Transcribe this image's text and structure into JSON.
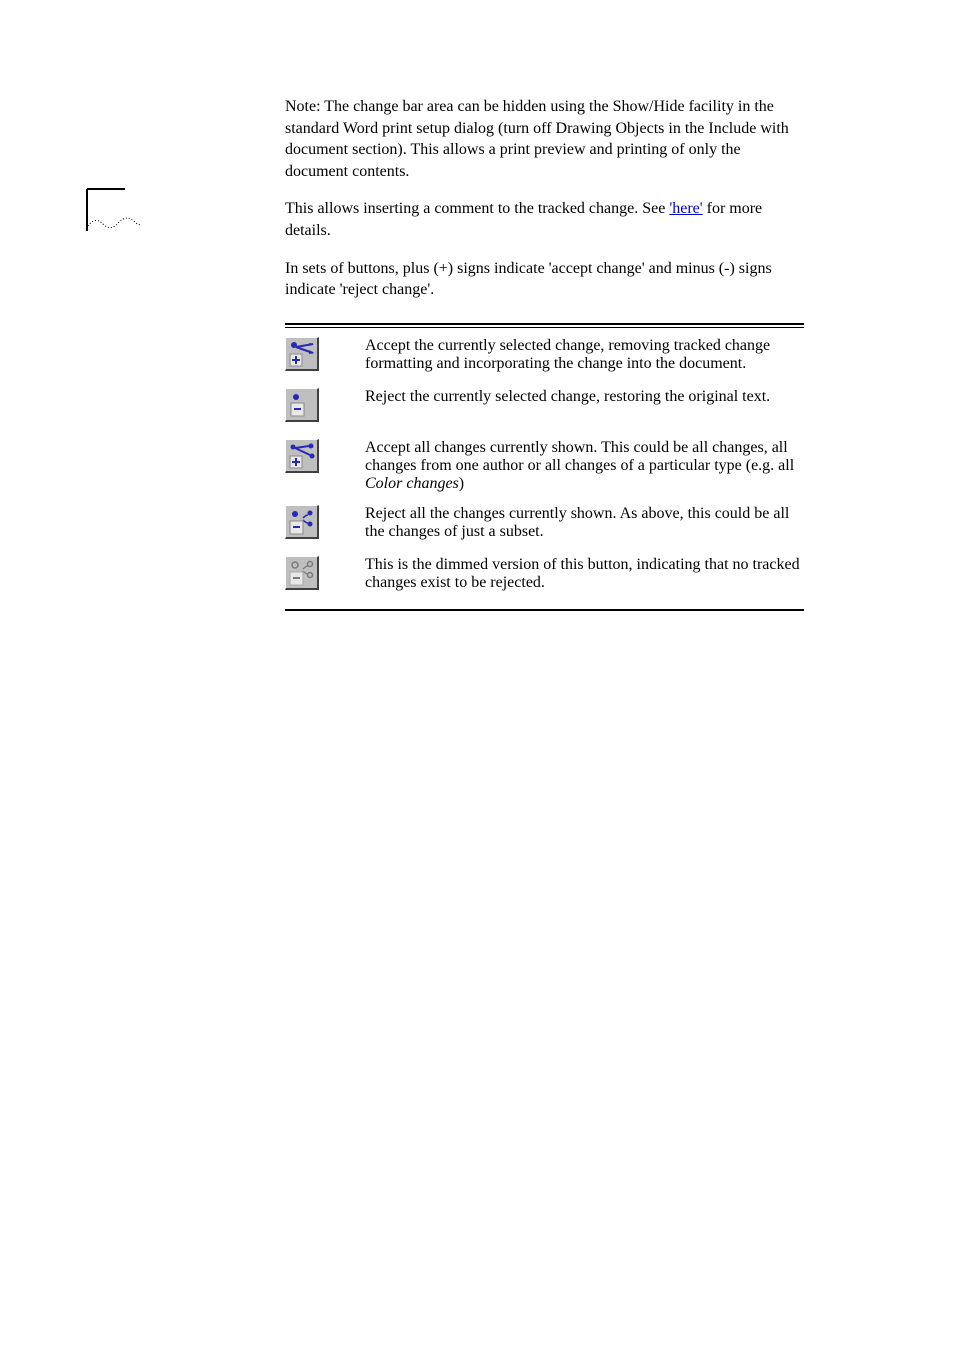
{
  "paragraphs": {
    "p1": "Note: The change bar area can be hidden using the Show/Hide facility in the standard Word print setup dialog (turn off Drawing Objects in the Include with document section). This allows a print preview and printing of only the document contents.",
    "p2_prefix": "This allows inserting a comment to the tracked change. See ",
    "p2_link": "'here'",
    "p2_suffix": " for more details.",
    "p3": "In sets of buttons, plus (+) signs indicate 'accept change' and minus (-) signs indicate 'reject change'."
  },
  "table": [
    {
      "icon": "accept-change-icon",
      "text": "Accept the currently selected change, removing tracked change formatting and incorporating the change into the document."
    },
    {
      "icon": "reject-change-icon",
      "text": "Reject the currently selected change, restoring the original text."
    },
    {
      "icon": "accept-all-shown-icon",
      "text_prefix": "Accept all changes currently shown. This could be all changes, all changes from one author or all changes of a particular type (e.g. all ",
      "text_italic": "Color changes",
      "text_suffix": ")"
    },
    {
      "icon": "reject-all-shown-icon",
      "text": "Reject all the changes currently shown. As above, this could be all the changes of just a subset."
    },
    {
      "icon": "reject-all-disabled-icon",
      "text": "This is the dimmed version of this button, indicating that no tracked changes exist to be rejected."
    }
  ]
}
